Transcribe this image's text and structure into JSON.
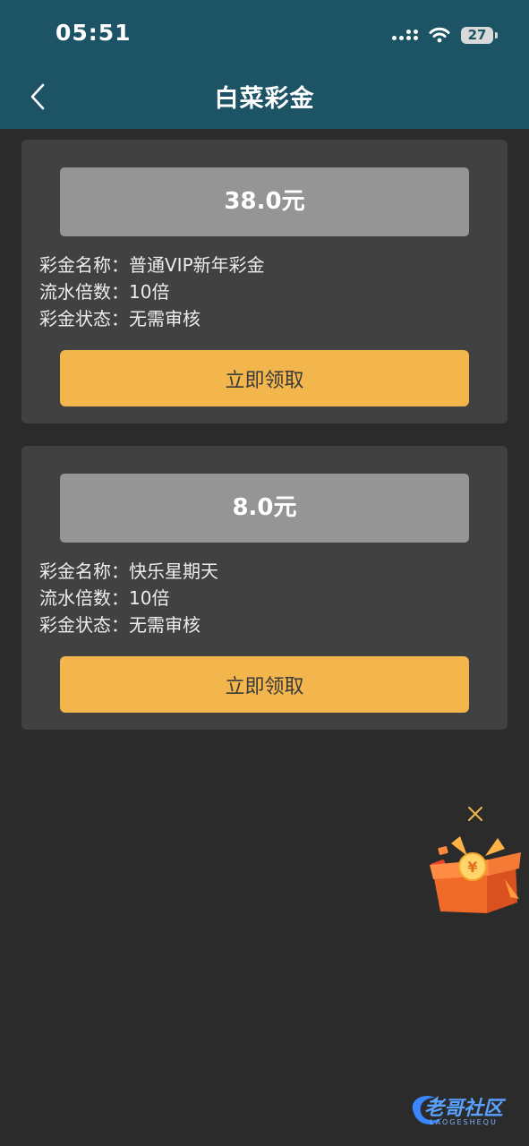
{
  "status_bar": {
    "time": "05:51",
    "battery": "27"
  },
  "header": {
    "title": "白菜彩金"
  },
  "bonuses": [
    {
      "amount": "38.0元",
      "name_line": "彩金名称：普通VIP新年彩金",
      "multiplier_line": "流水倍数：10倍",
      "status_line": "彩金状态：无需审核",
      "button": "立即领取"
    },
    {
      "amount": "8.0元",
      "name_line": "彩金名称：快乐星期天",
      "multiplier_line": "流水倍数：10倍",
      "status_line": "彩金状态：无需审核",
      "button": "立即领取"
    }
  ],
  "watermark": {
    "text": "老哥社区",
    "sub": "LAOGESHEQU"
  },
  "colors": {
    "header_bg": "#1c5365",
    "page_bg": "#2b2b2b",
    "card_bg": "#414141",
    "amount_bg": "#959595",
    "button_bg": "#f2b64c",
    "gift_orange": "#f06a2a"
  },
  "icons": {
    "back": "chevron-left-icon",
    "signal": "cellular-signal-icon",
    "wifi": "wifi-icon",
    "battery": "battery-icon",
    "close": "close-icon",
    "gift": "gift-box-icon"
  }
}
